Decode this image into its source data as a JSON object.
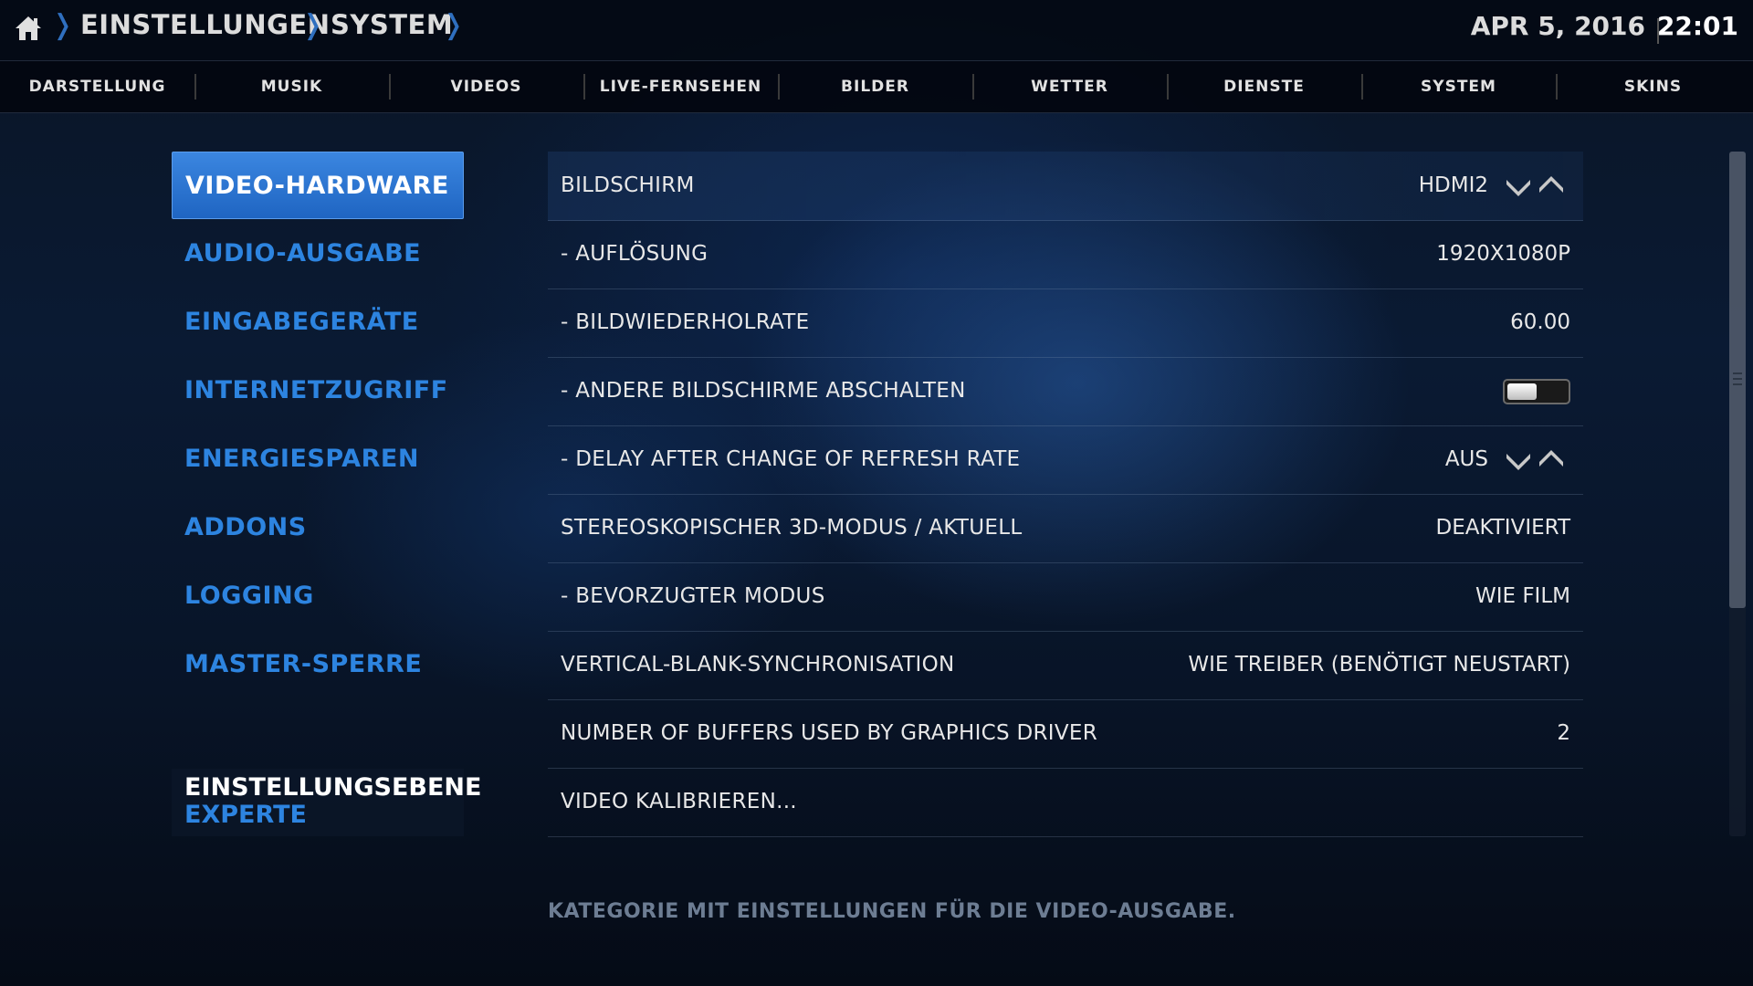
{
  "breadcrumb": {
    "home_icon": "home-icon",
    "items": [
      "EINSTELLUNGEN",
      "SYSTEM"
    ]
  },
  "clock": {
    "date": "APR 5, 2016",
    "time": "22:01"
  },
  "tabs": [
    "DARSTELLUNG",
    "MUSIK",
    "VIDEOS",
    "LIVE-FERNSEHEN",
    "BILDER",
    "WETTER",
    "DIENSTE",
    "SYSTEM",
    "SKINS"
  ],
  "sidebar": {
    "items": [
      "VIDEO-HARDWARE",
      "AUDIO-AUSGABE",
      "EINGABEGERÄTE",
      "INTERNETZUGRIFF",
      "ENERGIESPAREN",
      "ADDONS",
      "LOGGING",
      "MASTER-SPERRE"
    ],
    "active_index": 0,
    "level_title": "EINSTELLUNGSEBENE",
    "level_value": "EXPERTE"
  },
  "settings": [
    {
      "label": "BILDSCHIRM",
      "value": "HDMI2",
      "control": "spinner"
    },
    {
      "label": "- AUFLÖSUNG",
      "value": "1920X1080P",
      "control": "text"
    },
    {
      "label": "- BILDWIEDERHOLRATE",
      "value": "60.00",
      "control": "text"
    },
    {
      "label": "- ANDERE BILDSCHIRME ABSCHALTEN",
      "value": "",
      "control": "toggle",
      "toggle_on": false
    },
    {
      "label": "- DELAY AFTER CHANGE OF REFRESH RATE",
      "value": "AUS",
      "control": "spinner"
    },
    {
      "label": "STEREOSKOPISCHER 3D-MODUS / AKTUELL",
      "value": "DEAKTIVIERT",
      "control": "text"
    },
    {
      "label": "- BEVORZUGTER MODUS",
      "value": "WIE FILM",
      "control": "text"
    },
    {
      "label": "VERTICAL-BLANK-SYNCHRONISATION",
      "value": "WIE TREIBER (BENÖTIGT NEUSTART)",
      "control": "text"
    },
    {
      "label": "NUMBER OF BUFFERS USED BY GRAPHICS DRIVER",
      "value": "2",
      "control": "text"
    },
    {
      "label": "VIDEO KALIBRIEREN...",
      "value": "",
      "control": "button"
    }
  ],
  "description": "KATEGORIE MIT EINSTELLUNGEN FÜR DIE VIDEO-AUSGABE.",
  "colors": {
    "accent": "#2d84e0",
    "active_bg": "#2a74d4",
    "separator": "#2f6fbf"
  }
}
